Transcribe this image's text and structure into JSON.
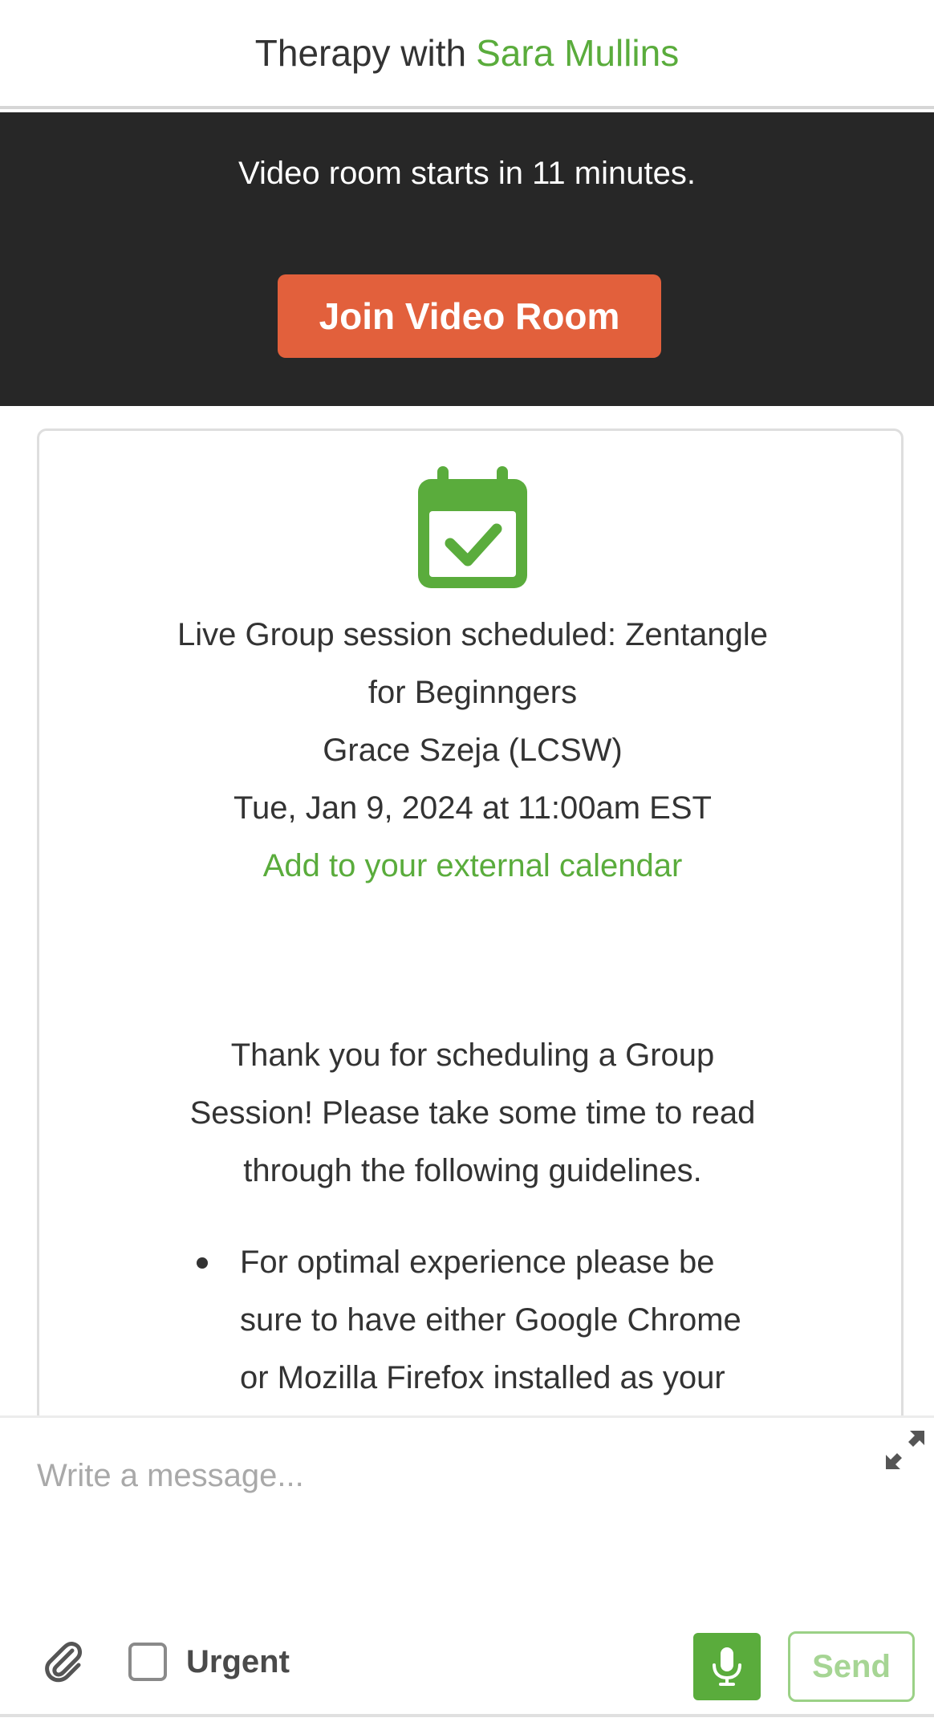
{
  "header": {
    "title_prefix": "Therapy with",
    "therapist_name": "Sara Mullins"
  },
  "banner": {
    "notice": "Video room starts in 11 minutes.",
    "join_button": "Join Video Room"
  },
  "session_card": {
    "icon": "calendar-check-icon",
    "title_line1": "Live Group session scheduled: Zentangle",
    "title_line2": "for Beginngers",
    "host": "Grace Szeja (LCSW)",
    "datetime": "Tue, Jan 9, 2024 at 11:00am EST",
    "calendar_link": "Add to your external calendar",
    "intro_line1": "Thank you for scheduling a Group",
    "intro_line2": "Session! Please take some time to read",
    "intro_line3": "through the following guidelines.",
    "guidelines": [
      {
        "line1": "For optimal experience please be",
        "line2": "sure to have either Google Chrome",
        "line3": "or Mozilla Firefox installed as your"
      }
    ]
  },
  "composer": {
    "placeholder": "Write a message...",
    "urgent_label": "Urgent",
    "urgent_checked": false,
    "send_label": "Send",
    "icons": {
      "expand": "expand-icon",
      "attach": "paperclip-icon",
      "mic": "microphone-icon"
    }
  },
  "colors": {
    "brand_green": "#5aac3c",
    "join_orange": "#e2603c",
    "banner_dark": "#272727",
    "send_green_light": "#a6d594"
  }
}
